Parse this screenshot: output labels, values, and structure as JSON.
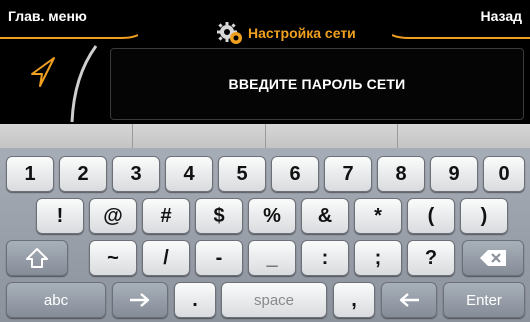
{
  "header": {
    "main_menu": "Глав. меню",
    "title": "Настройка сети",
    "back": "Назад",
    "accent": "#f0a020"
  },
  "password_prompt": "ВВЕДИТЕ ПАРОЛЬ СЕТИ",
  "keyboard": {
    "row1": [
      "1",
      "2",
      "3",
      "4",
      "5",
      "6",
      "7",
      "8",
      "9",
      "0"
    ],
    "row2": [
      "!",
      "@",
      "#",
      "$",
      "%",
      "&",
      "*",
      "(",
      ")"
    ],
    "row3": [
      "~",
      "/",
      "-",
      "_",
      ":",
      ";",
      "?"
    ],
    "abc": "abc",
    "space": "space",
    "comma": ",",
    "period": ".",
    "enter": "Enter",
    "icons": {
      "shift": "shift-icon",
      "backspace": "backspace-icon",
      "cursor_right": "arrow-right-icon",
      "cursor_left": "arrow-left-icon"
    }
  }
}
